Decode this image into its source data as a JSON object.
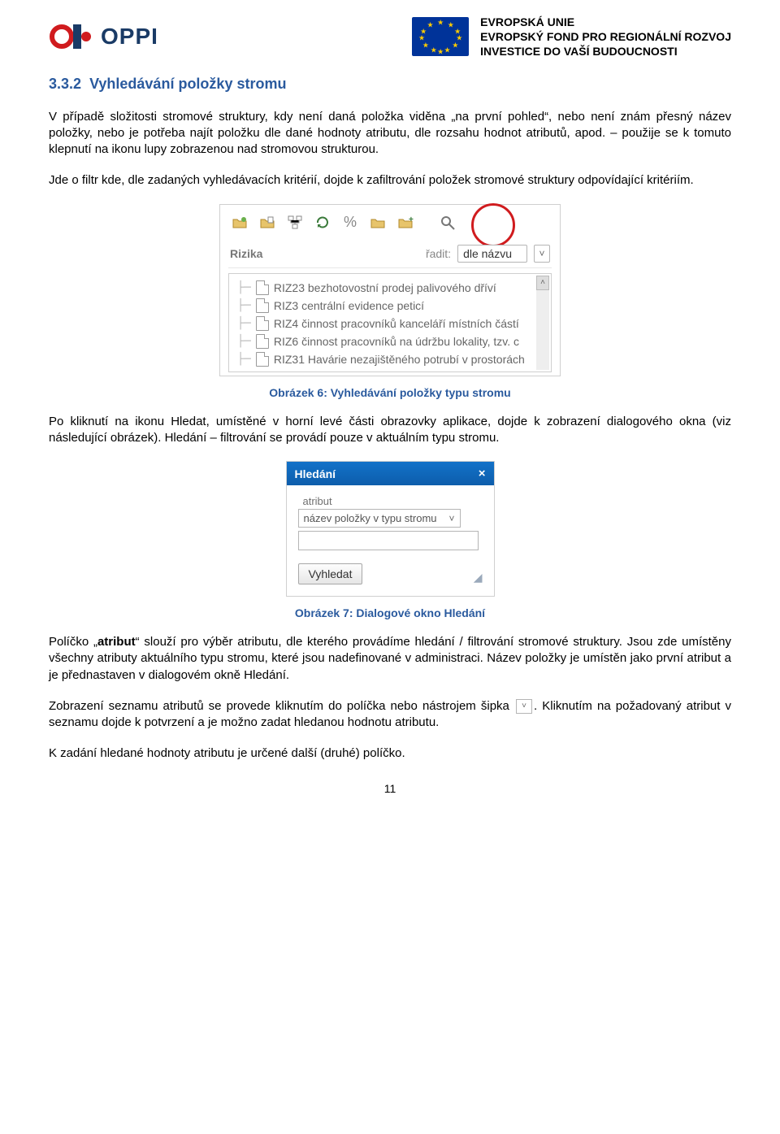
{
  "header": {
    "oppi_text": "OPPI",
    "eu_line1": "EVROPSKÁ UNIE",
    "eu_line2": "EVROPSKÝ FOND PRO REGIONÁLNÍ ROZVOJ",
    "eu_line3": "INVESTICE DO VAŠÍ BUDOUCNOSTI"
  },
  "section": {
    "number": "3.3.2",
    "title": "Vyhledávání položky stromu"
  },
  "paragraphs": {
    "p1": "V případě složitosti stromové struktury, kdy není daná položka viděna „na první pohled“, nebo není znám přesný název položky, nebo je potřeba najít položku dle dané hodnoty atributu, dle rozsahu hodnot atributů, apod. – použije se k tomuto klepnutí na ikonu lupy zobrazenou nad stromovou strukturou.",
    "p2": "Jde o filtr kde, dle zadaných vyhledávacích kritérií, dojde k zafiltrování položek stromové struktury odpovídající kritériím.",
    "p3": "Po kliknutí na ikonu Hledat, umístěné v horní levé části obrazovky aplikace, dojde k zobrazení dialogového okna (viz následující obrázek). Hledání – filtrování se provádí pouze v aktuálním typu stromu.",
    "p4_a": "Políčko „",
    "p4_attr": "atribut",
    "p4_b": "“ slouží pro výběr atributu, dle kterého provádíme hledání / filtrování stromové struktury. Jsou zde umístěny všechny atributy aktuálního typu stromu, které jsou nadefinované v administraci. Název položky je umístěn jako první atribut a je přednastaven v dialogovém okně Hledání.",
    "p5_a": "Zobrazení seznamu atributů se provede kliknutím do políčka nebo nástrojem šipka ",
    "p5_b": ". Kliknutím na požadovaný atribut v seznamu dojde k potvrzení a je možno zadat hledanou hodnotu atributu.",
    "p6": "K zadání hledané hodnoty atributu je určené další (druhé) políčko."
  },
  "figure6": {
    "caption": "Obrázek 6: Vyhledávání položky typu stromu",
    "panel_title": "Rizika",
    "sort_label": "řadit:",
    "sort_value": "dle názvu",
    "tree_items": [
      "RIZ23 bezhotovostní prodej palivového dříví",
      "RIZ3 centrální evidence peticí",
      "RIZ4 činnost pracovníků kanceláří místních částí",
      "RIZ6 činnost pracovníků na údržbu lokality, tzv. c",
      "RIZ31 Havárie nezajištěného potrubí v prostorách"
    ]
  },
  "figure7": {
    "caption": "Obrázek 7: Dialogové okno Hledání",
    "title": "Hledání",
    "close": "×",
    "field_label": "atribut",
    "select_value": "název položky v typu stromu",
    "button": "Vyhledat"
  },
  "page_number": "11"
}
